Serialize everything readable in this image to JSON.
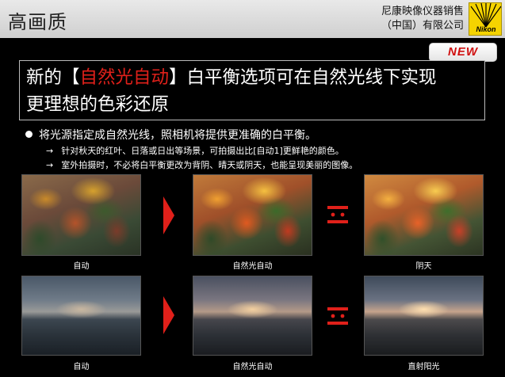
{
  "header": {
    "title": "高画质",
    "company_line1": "尼康映像仪器销售",
    "company_line2": "（中国）有限公司",
    "logo_text": "Nikon"
  },
  "badge": {
    "label": "NEW"
  },
  "headline": {
    "line1_pre": "新的【",
    "line1_highlight": "自然光自动",
    "line1_post": "】白平衡选项可在自然光线下实现",
    "line2": "更理想的色彩还原"
  },
  "bullets": {
    "main": "将光源指定成自然光线，照相机将提供更准确的白平衡。",
    "sub1": "针对秋天的红叶、日落或日出等场景，可拍摄出比[自动1]更鲜艳的颜色。",
    "sub2": "室外拍摄时，不必将白平衡更改为背阴、晴天或阴天，也能呈现美丽的图像。",
    "arrow": "→"
  },
  "row1": {
    "caption1": "自动",
    "caption2": "自然光自动",
    "caption3": "阴天"
  },
  "row2": {
    "caption1": "自动",
    "caption2": "自然光自动",
    "caption3": "直射阳光"
  },
  "colors": {
    "accent_red": "#e0201a",
    "header_bg": "#dcdcdc",
    "logo_yellow": "#f5d300"
  }
}
